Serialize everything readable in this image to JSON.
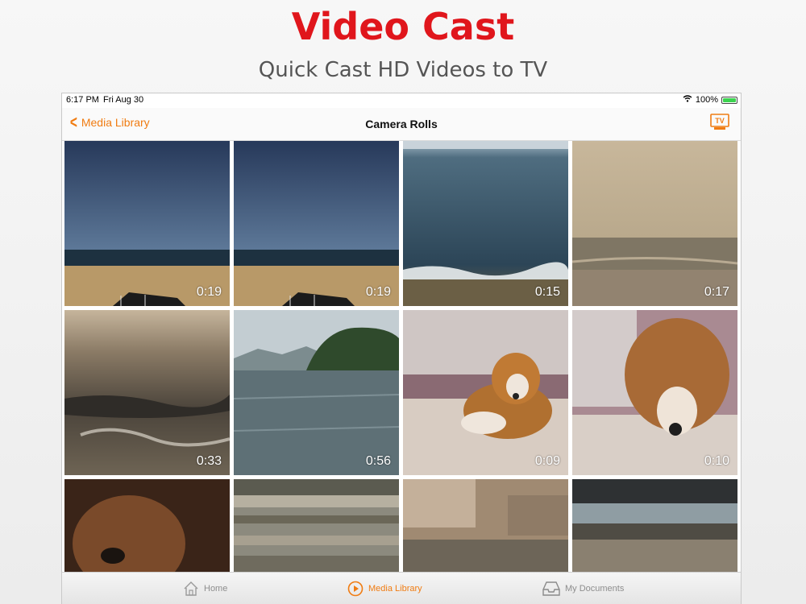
{
  "promo": {
    "title": "Video Cast",
    "subtitle": "Quick Cast HD Videos to TV"
  },
  "statusbar": {
    "time": "6:17 PM",
    "date": "Fri Aug 30",
    "battery": "100%"
  },
  "navbar": {
    "back_label": "Media Library",
    "title": "Camera Rolls",
    "tv_label": "TV"
  },
  "videos": [
    {
      "duration": "0:19"
    },
    {
      "duration": "0:19"
    },
    {
      "duration": "0:15"
    },
    {
      "duration": "0:17"
    },
    {
      "duration": "0:33"
    },
    {
      "duration": "0:56"
    },
    {
      "duration": "0:09"
    },
    {
      "duration": "0:10"
    }
  ],
  "tabs": [
    {
      "label": "Home",
      "icon": "home-icon",
      "active": false
    },
    {
      "label": "Media Library",
      "icon": "play-circle-icon",
      "active": true
    },
    {
      "label": "My Documents",
      "icon": "inbox-tray-icon",
      "active": false
    }
  ],
  "colors": {
    "accent": "#f07c12",
    "promo_title": "#e0161c"
  }
}
